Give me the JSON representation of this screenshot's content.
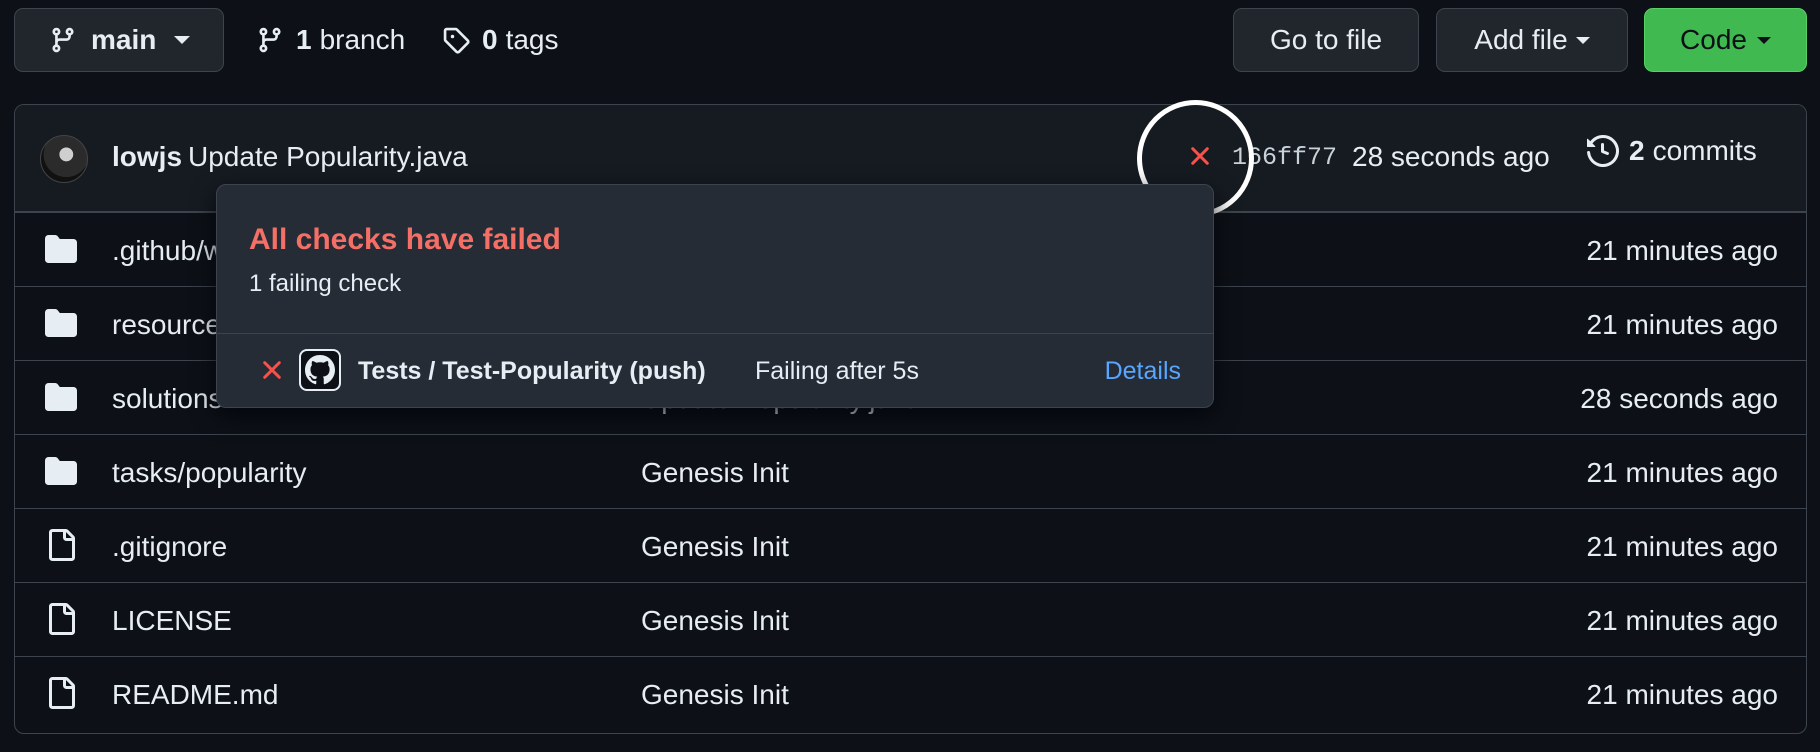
{
  "toolbar": {
    "branch_name": "main",
    "branches_count": "1",
    "branches_label": "branch",
    "tags_count": "0",
    "tags_label": "tags",
    "goto_file": "Go to file",
    "add_file": "Add file",
    "code": "Code"
  },
  "commit": {
    "author": "lowjs",
    "message": "Update Popularity.java",
    "status_icon": "x-icon",
    "sha": "166ff77",
    "time": "28 seconds ago",
    "commits_count": "2",
    "commits_label": "commits"
  },
  "files": [
    {
      "type": "folder",
      "name": ".github/workflows",
      "message": "",
      "time": "21 minutes ago"
    },
    {
      "type": "folder",
      "name": "resources",
      "message": "",
      "time": "21 minutes ago"
    },
    {
      "type": "folder",
      "name": "solutions",
      "message": "Update Popularity.java",
      "time": "28 seconds ago"
    },
    {
      "type": "folder",
      "name": "tasks/popularity",
      "message": "Genesis Init",
      "time": "21 minutes ago"
    },
    {
      "type": "file",
      "name": ".gitignore",
      "message": "Genesis Init",
      "time": "21 minutes ago"
    },
    {
      "type": "file",
      "name": "LICENSE",
      "message": "Genesis Init",
      "time": "21 minutes ago"
    },
    {
      "type": "file",
      "name": "README.md",
      "message": "Genesis Init",
      "time": "21 minutes ago"
    }
  ],
  "popover": {
    "title": "All checks have failed",
    "subtitle": "1 failing check",
    "check_name": "Tests / Test-Popularity (push)",
    "check_status": "Failing after 5s",
    "details": "Details"
  },
  "colors": {
    "background": "#0d1117",
    "fail_red": "#f85149",
    "link_blue": "#58a6ff",
    "code_green": "#3fb950"
  }
}
